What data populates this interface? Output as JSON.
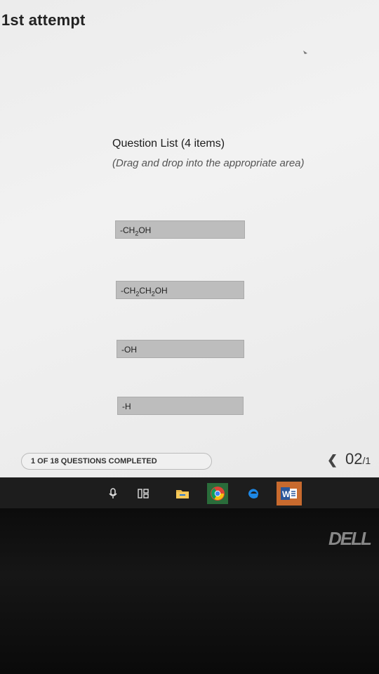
{
  "header": {
    "attempt": "1st attempt"
  },
  "question_list": {
    "title": "Question List (4 items)",
    "subtitle": "(Drag and drop into the appropriate area)"
  },
  "items": [
    {
      "parts": [
        "-CH",
        "2",
        "OH"
      ]
    },
    {
      "parts": [
        "-CH",
        "2",
        "CH",
        "2",
        "OH"
      ]
    },
    {
      "parts": [
        "-OH"
      ]
    },
    {
      "parts": [
        "-H"
      ]
    }
  ],
  "footer": {
    "progress": "1 OF 18 QUESTIONS COMPLETED",
    "page": "02",
    "page_suffix": "/1"
  },
  "brand": "DELL",
  "taskbar_icons": [
    "microphone-icon",
    "task-view-icon",
    "file-explorer-icon",
    "chrome-icon",
    "edge-icon",
    "word-icon"
  ]
}
